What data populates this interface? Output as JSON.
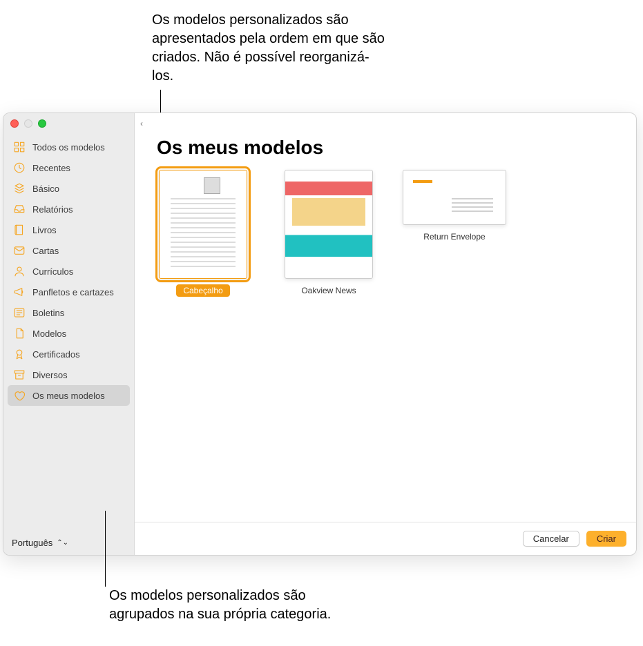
{
  "callouts": {
    "top": "Os modelos personalizados são apresentados pela ordem em que são criados. Não é possível reorganizá-los.",
    "bottom": "Os modelos personalizados são agrupados na sua própria categoria."
  },
  "sidebar": {
    "categories": [
      {
        "icon": "grid",
        "label": "Todos os modelos"
      },
      {
        "icon": "clock",
        "label": "Recentes"
      },
      {
        "icon": "stack",
        "label": "Básico"
      },
      {
        "icon": "inbox",
        "label": "Relatórios"
      },
      {
        "icon": "book",
        "label": "Livros"
      },
      {
        "icon": "mail",
        "label": "Cartas"
      },
      {
        "icon": "person",
        "label": "Currículos"
      },
      {
        "icon": "megaphone",
        "label": "Panfletos e cartazes"
      },
      {
        "icon": "news",
        "label": "Boletins"
      },
      {
        "icon": "doc",
        "label": "Modelos"
      },
      {
        "icon": "ribbon",
        "label": "Certificados"
      },
      {
        "icon": "archive",
        "label": "Diversos"
      },
      {
        "icon": "heart",
        "label": "Os meus modelos"
      }
    ],
    "selected_index": 12,
    "language": "Português"
  },
  "main": {
    "heading": "Os meus modelos",
    "templates": [
      {
        "name": "Cabeçalho",
        "thumb": "letter",
        "orientation": "portrait",
        "selected": true
      },
      {
        "name": "Oakview News",
        "thumb": "news",
        "orientation": "portrait",
        "selected": false
      },
      {
        "name": "Return Envelope",
        "thumb": "envelope",
        "orientation": "landscape",
        "selected": false
      }
    ]
  },
  "footer": {
    "cancel": "Cancelar",
    "create": "Criar"
  },
  "icon_colors": {
    "accent": "#f5a623"
  }
}
